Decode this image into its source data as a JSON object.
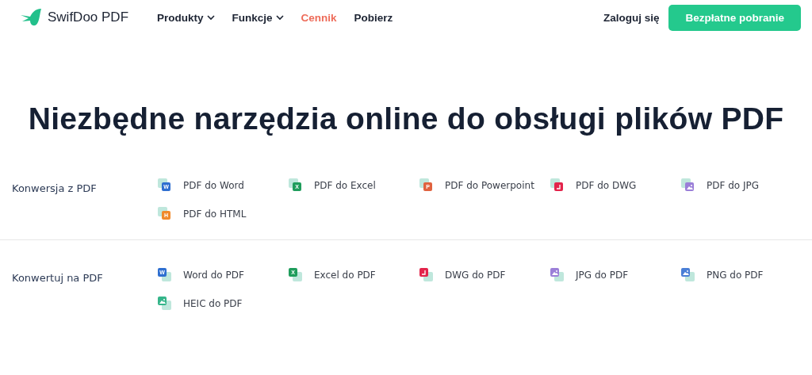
{
  "nav": {
    "brand": "SwifDoo PDF",
    "menu": [
      {
        "label": "Produkty",
        "dropdown": true,
        "selected": false
      },
      {
        "label": "Funkcje",
        "dropdown": true,
        "selected": false
      },
      {
        "label": "Cennik",
        "dropdown": false,
        "selected": true
      },
      {
        "label": "Pobierz",
        "dropdown": false,
        "selected": false
      }
    ],
    "login": "Zaloguj się",
    "cta": "Bezpłatne pobranie"
  },
  "title": "Niezbędne narzędzia online do obsługi plików PDF",
  "sections": [
    {
      "label": "Konwersja z PDF",
      "kind": "from",
      "tools": [
        {
          "label": "PDF do Word",
          "kind": "letter",
          "badge": "W",
          "color": "#2f6fd0"
        },
        {
          "label": "PDF do Excel",
          "kind": "letter",
          "badge": "X",
          "color": "#1f9d5c"
        },
        {
          "label": "PDF do Powerpoint",
          "kind": "letter",
          "badge": "P",
          "color": "#e0623f"
        },
        {
          "label": "PDF do DWG",
          "kind": "dwg",
          "color": "#e3244b"
        },
        {
          "label": "PDF do JPG",
          "kind": "image",
          "color": "#9b7fd8"
        },
        {
          "label": "PDF do HTML",
          "kind": "letter",
          "badge": "H",
          "color": "#f08a2c"
        }
      ]
    },
    {
      "label": "Konwertuj na PDF",
      "kind": "to",
      "tools": [
        {
          "label": "Word do PDF",
          "kind": "letter",
          "badge": "W",
          "color": "#2f6fd0"
        },
        {
          "label": "Excel do PDF",
          "kind": "letter",
          "badge": "X",
          "color": "#1f9d5c"
        },
        {
          "label": "DWG do PDF",
          "kind": "dwg",
          "color": "#e3244b"
        },
        {
          "label": "JPG do PDF",
          "kind": "image",
          "color": "#9b7fd8"
        },
        {
          "label": "PNG do PDF",
          "kind": "image",
          "color": "#4a7fd6"
        },
        {
          "label": "HEIC do PDF",
          "kind": "image",
          "color": "#35b58a"
        }
      ]
    }
  ]
}
